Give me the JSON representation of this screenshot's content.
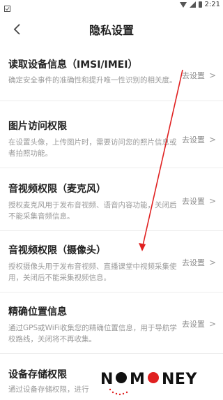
{
  "status_bar": {
    "time": "2:21"
  },
  "header": {
    "title": "隐私设置"
  },
  "items": [
    {
      "title": "读取设备信息（IMSI/IMEI）",
      "desc": "确定安全事件的准确性和提升唯一性识别的相关度。",
      "action": "去设置"
    },
    {
      "title": "图片访问权限",
      "desc": "在设置头像，上传图片时，需要访问您的照片信息或者拍照功能。",
      "action": "去设置"
    },
    {
      "title": "音视频权限（麦克风）",
      "desc": "授权麦克风用于发布音视频、语音内容功能，关闭后不能采集音频信息。",
      "action": "去设置"
    },
    {
      "title": "音视频权限（摄像头）",
      "desc": "授权摄像头用于发布音视频、直播课堂中视频采集使用，关闭后不能采集视频信息。",
      "action": "去设置"
    },
    {
      "title": "精确位置信息",
      "desc": "通过GPS或WiFi收集您的精确位置信息，用于导航学校路线，关闭将不再收集。",
      "action": "去设置"
    },
    {
      "title": "设备存储权限",
      "desc": "通过设备存储权限，进行",
      "action": ""
    }
  ],
  "watermark": {
    "text": "NOMONEY"
  },
  "colors": {
    "annotation_arrow": "#e02020"
  }
}
